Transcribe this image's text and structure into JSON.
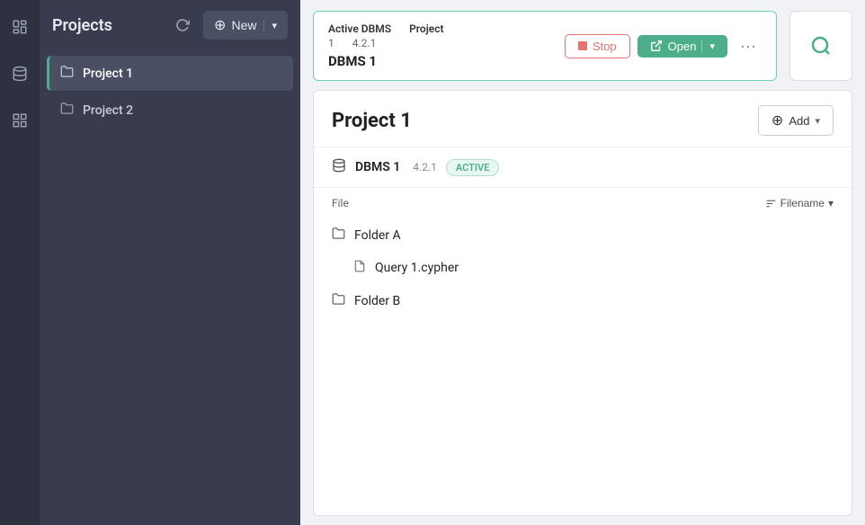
{
  "sidebar": {
    "title": "Projects",
    "new_label": "New",
    "items": [
      {
        "id": "project-1",
        "label": "Project 1",
        "active": true
      },
      {
        "id": "project-2",
        "label": "Project 2",
        "active": false
      }
    ]
  },
  "top_bar": {
    "active_label": "Active DBMS",
    "id_label": "1",
    "version_label": "4.2.1",
    "project_label": "Project",
    "dbms_name": "DBMS 1",
    "stop_label": "Stop",
    "open_label": "Open",
    "more_label": "···"
  },
  "project": {
    "title": "Project 1",
    "add_label": "Add",
    "dbms_name": "DBMS 1",
    "dbms_version": "4.2.1",
    "active_badge": "ACTIVE",
    "file_col_label": "File",
    "filename_sort_label": "Filename",
    "items": [
      {
        "type": "folder",
        "name": "Folder A",
        "indent": false
      },
      {
        "type": "file",
        "name": "Query 1.cypher",
        "indent": true
      },
      {
        "type": "folder",
        "name": "Folder B",
        "indent": false
      }
    ]
  },
  "icons": {
    "rail_pages": "☰",
    "rail_db": "🗄",
    "rail_grid": "⊞",
    "rail_search": "🔍",
    "refresh": "↻",
    "folder": "🗀",
    "file": "🗋",
    "db": "🗄",
    "plus": "+",
    "sort": "≡",
    "stop": "■",
    "open_arrow": "↗"
  }
}
